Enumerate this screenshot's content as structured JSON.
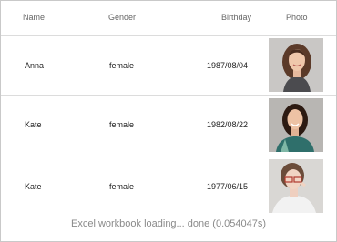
{
  "table": {
    "columns": [
      "Name",
      "Gender",
      "Birthday",
      "Photo"
    ],
    "rows": [
      {
        "name": "Anna",
        "gender": "female",
        "birthday": "1987/08/04",
        "photo": "photo-anna"
      },
      {
        "name": "Kate",
        "gender": "female",
        "birthday": "1982/08/22",
        "photo": "photo-kate-1"
      },
      {
        "name": "Kate",
        "gender": "female",
        "birthday": "1977/06/15",
        "photo": "photo-kate-2"
      }
    ]
  },
  "status": {
    "text": "Excel workbook loading... done (0.054047s)"
  }
}
